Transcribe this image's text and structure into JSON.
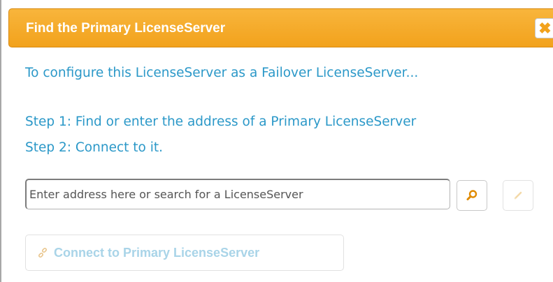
{
  "dialog": {
    "title": "Find the Primary LicenseServer",
    "close_icon": "close-icon",
    "intro": "To configure this LicenseServer as a Failover LicenseServer...",
    "step1": "Step 1: Find or enter the address of a Primary LicenseServer",
    "step2": "Step 2: Connect to it.",
    "address_input": {
      "value": "",
      "placeholder": "Enter address here or search for a LicenseServer"
    },
    "search_icon": "search-icon",
    "edit_icon": "pencil-icon",
    "connect_button": {
      "label": "Connect to Primary LicenseServer",
      "icon": "link-icon",
      "enabled": false
    }
  },
  "colors": {
    "title_bar": "#f2a21c",
    "title_text": "#ffffff",
    "body_text": "#2b98c8",
    "disabled_text": "#a9d4e8",
    "close_icon": "#f2a21c",
    "search_icon": "#e08a00"
  }
}
